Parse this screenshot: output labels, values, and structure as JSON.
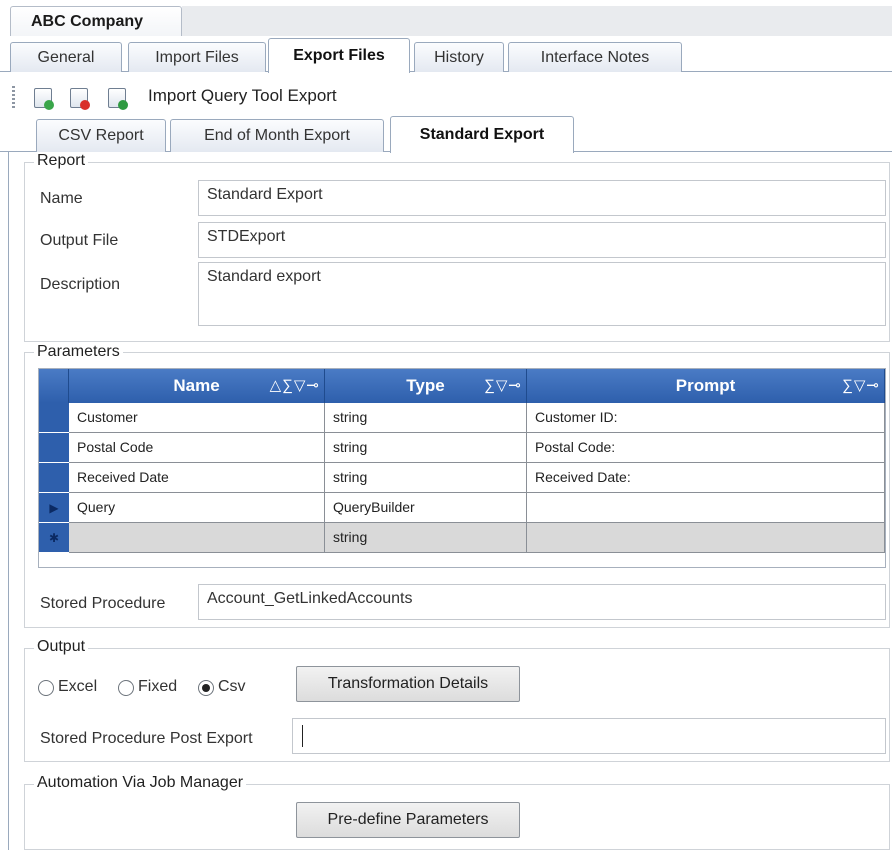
{
  "window": {
    "doc_tab_title": "ABC Company"
  },
  "main_tabs": [
    {
      "label": "General"
    },
    {
      "label": "Import Files"
    },
    {
      "label": "Export Files"
    },
    {
      "label": "History"
    },
    {
      "label": "Interface Notes"
    }
  ],
  "toolbar": {
    "icons": [
      "add-export-icon",
      "delete-export-icon",
      "import-export-icon"
    ],
    "label": "Import Query Tool Export"
  },
  "sub_tabs": [
    {
      "label": "CSV Report"
    },
    {
      "label": "End of Month Export"
    },
    {
      "label": "Standard Export"
    }
  ],
  "report": {
    "group_label": "Report",
    "name_label": "Name",
    "name_value": "Standard Export",
    "output_file_label": "Output File",
    "output_file_value": "STDExport",
    "description_label": "Description",
    "description_value": "Standard export"
  },
  "parameters": {
    "group_label": "Parameters",
    "columns": [
      {
        "label": "Name",
        "icons": "△∑▽⊸"
      },
      {
        "label": "Type",
        "icons": "∑▽⊸"
      },
      {
        "label": "Prompt",
        "icons": "∑▽⊸"
      }
    ],
    "rows": [
      {
        "indicator": "",
        "name": "Customer",
        "type": "string",
        "prompt": "Customer ID:"
      },
      {
        "indicator": "",
        "name": "Postal Code",
        "type": "string",
        "prompt": "Postal Code:"
      },
      {
        "indicator": "",
        "name": "Received Date",
        "type": "string",
        "prompt": "Received Date:"
      },
      {
        "indicator": "▶",
        "name": "Query",
        "type": "QueryBuilder",
        "prompt": ""
      },
      {
        "indicator": "✱",
        "name": "",
        "type": "string",
        "prompt": ""
      }
    ],
    "stored_procedure_label": "Stored Procedure",
    "stored_procedure_value": "Account_GetLinkedAccounts"
  },
  "output": {
    "group_label": "Output",
    "radio_excel": "Excel",
    "radio_fixed": "Fixed",
    "radio_csv": "Csv",
    "selected": "Csv",
    "transformation_button": "Transformation Details",
    "post_export_label": "Stored Procedure Post Export",
    "post_export_value": ""
  },
  "automation": {
    "group_label": "Automation Via Job Manager",
    "predefine_button": "Pre-define Parameters"
  }
}
